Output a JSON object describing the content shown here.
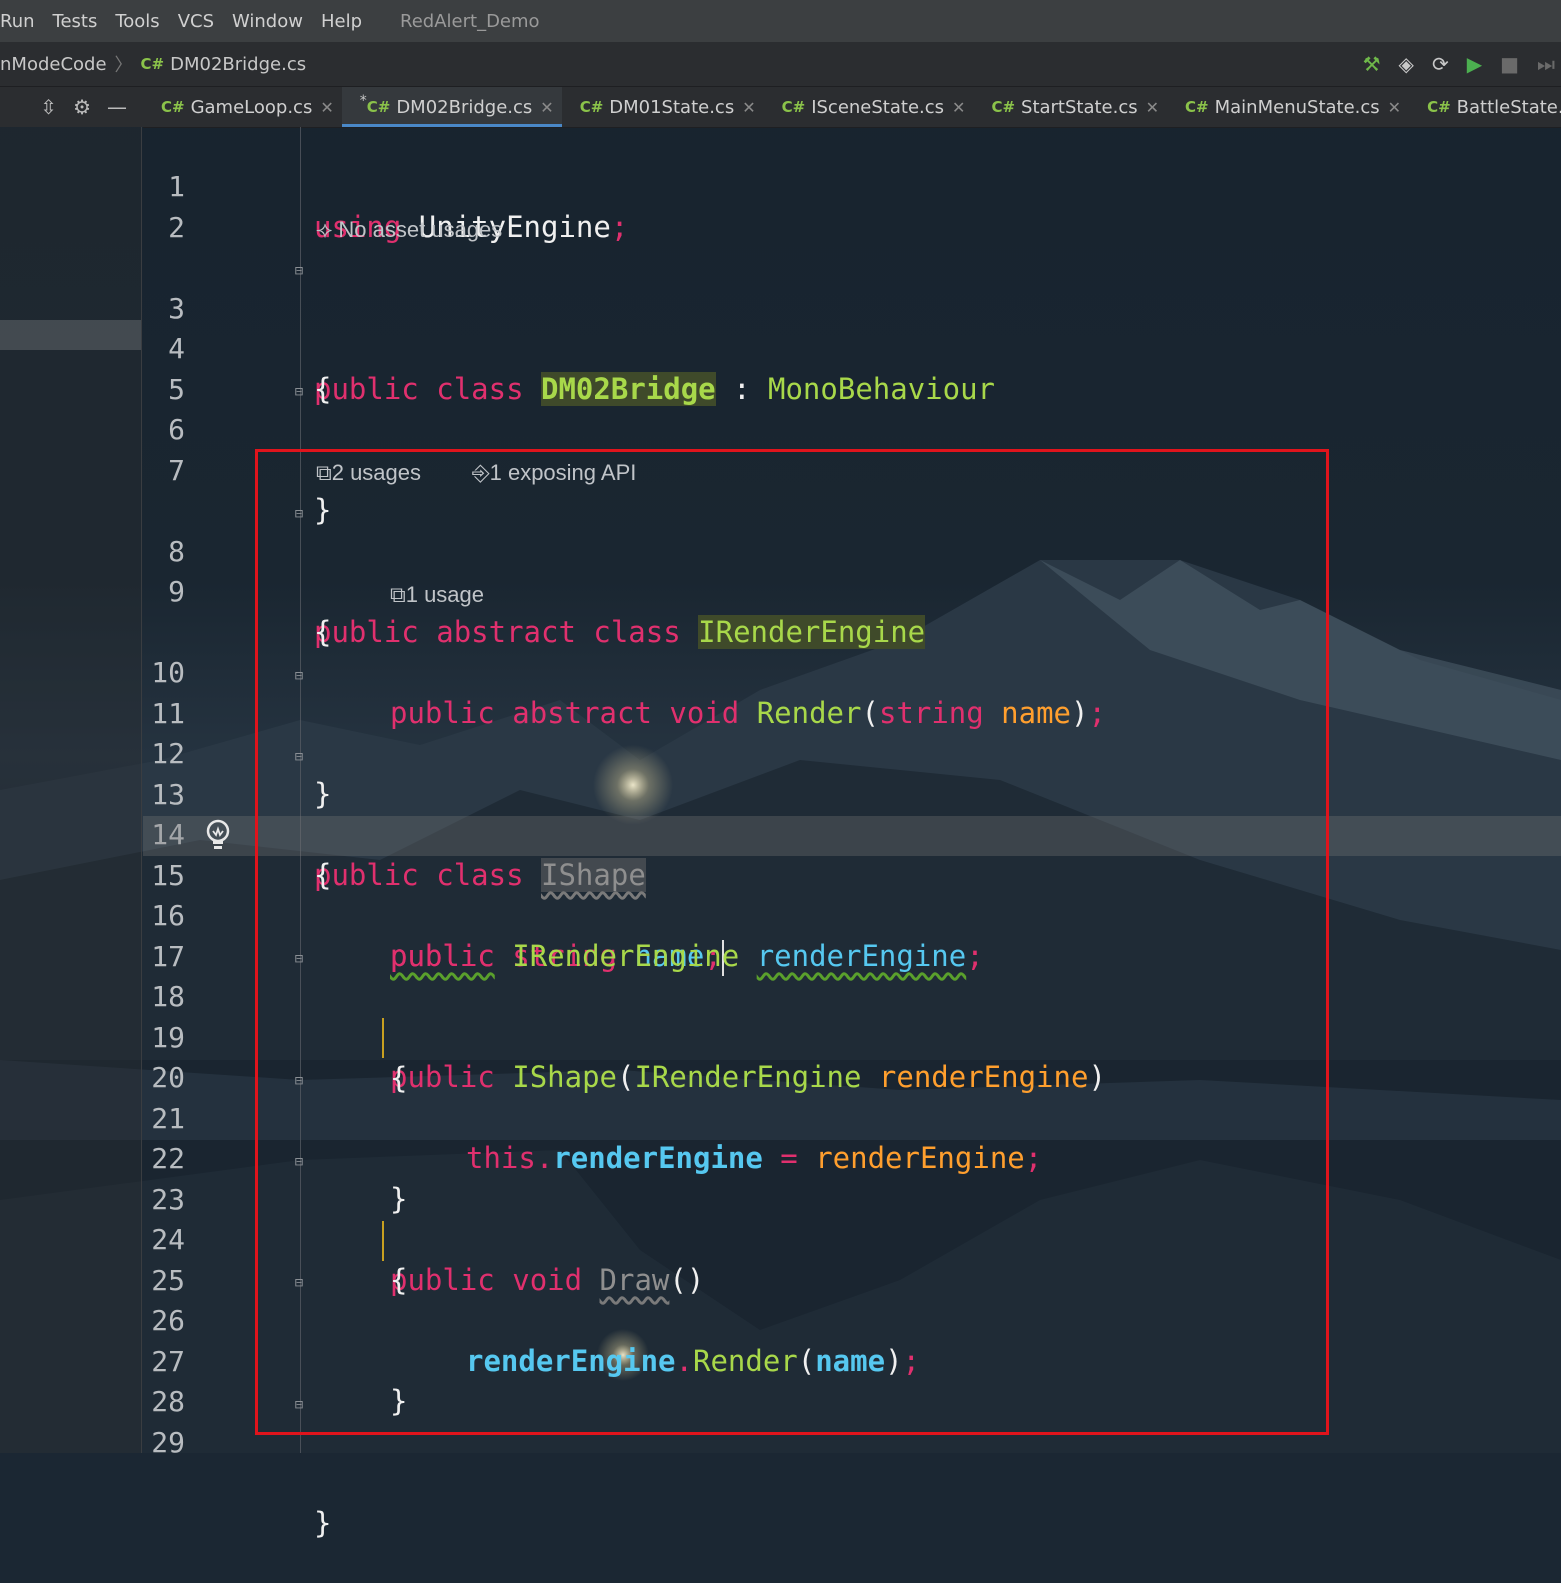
{
  "menubar": {
    "items": [
      "Run",
      "Tests",
      "Tools",
      "VCS",
      "Window",
      "Help"
    ],
    "project": "RedAlert_Demo"
  },
  "navbar": {
    "crumb_folder": "nModeCode",
    "crumb_file": "DM02Bridge.cs",
    "lang_badge": "C#",
    "tools": [
      "hammer-icon",
      "unity-icon",
      "refresh-icon",
      "run-icon",
      "stop-icon",
      "step-icon"
    ]
  },
  "tabs": [
    {
      "label": "GameLoop.cs",
      "badge": "C#",
      "active": false,
      "modified": false
    },
    {
      "label": "DM02Bridge.cs",
      "badge": "C#",
      "active": true,
      "modified": true
    },
    {
      "label": "DM01State.cs",
      "badge": "C#",
      "active": false,
      "modified": false
    },
    {
      "label": "ISceneState.cs",
      "badge": "C#",
      "active": false,
      "modified": false
    },
    {
      "label": "StartState.cs",
      "badge": "C#",
      "active": false,
      "modified": false
    },
    {
      "label": "MainMenuState.cs",
      "badge": "C#",
      "active": false,
      "modified": false
    },
    {
      "label": "BattleState.cs",
      "badge": "C#",
      "active": false,
      "modified": false
    }
  ],
  "hints": {
    "no_asset": "No asset usages",
    "usages2": "2 usages",
    "exposing": "1 exposing API",
    "usage1": "1 usage"
  },
  "line_numbers": [
    "1",
    "2",
    "3",
    "4",
    "5",
    "6",
    "7",
    "8",
    "9",
    "10",
    "11",
    "12",
    "13",
    "14",
    "15",
    "16",
    "17",
    "18",
    "19",
    "20",
    "21",
    "22",
    "23",
    "24",
    "25",
    "26",
    "27",
    "28",
    "29"
  ],
  "code": {
    "l1": [
      "using",
      " ",
      "UnityEngine",
      ";"
    ],
    "l3": [
      "public",
      " ",
      "class",
      " ",
      "DM02Bridge",
      " : ",
      "MonoBehaviour"
    ],
    "l4": "{",
    "l6": "}",
    "l8": [
      "public",
      " ",
      "abstract",
      " ",
      "class",
      " ",
      "IRenderEngine"
    ],
    "l9": "{",
    "l10": [
      "public",
      " ",
      "abstract",
      " ",
      "void",
      " ",
      "Render",
      "(",
      "string",
      " ",
      "name",
      ")",
      ";"
    ],
    "l11": "}",
    "l13": [
      "public",
      " ",
      "class",
      " ",
      "IShape"
    ],
    "l14": "{",
    "l15": [
      "public",
      " ",
      "string",
      " ",
      "name",
      ";"
    ],
    "l16": [
      "public",
      " ",
      "IRenderEngine",
      " ",
      "renderEngine",
      ";"
    ],
    "l18": [
      "public",
      " ",
      "IShape",
      "(",
      "IRenderEngine",
      " ",
      "renderEngine",
      ")"
    ],
    "l19": "{",
    "l20": [
      "this",
      ".",
      "renderEngine",
      " = ",
      "renderEngine",
      ";"
    ],
    "l21": "}",
    "l23": [
      "public",
      " ",
      "void",
      " ",
      "Draw",
      "()"
    ],
    "l24": "{",
    "l25": [
      "renderEngine",
      ".",
      "Render",
      "(",
      "name",
      ")",
      ";"
    ],
    "l26": "}",
    "l29": "}"
  },
  "colors": {
    "keyword": "#e0306e",
    "type": "#a8d84a",
    "parameter": "#ff9f2e",
    "field": "#56c8f0",
    "highlight_box": "#e0141c"
  }
}
